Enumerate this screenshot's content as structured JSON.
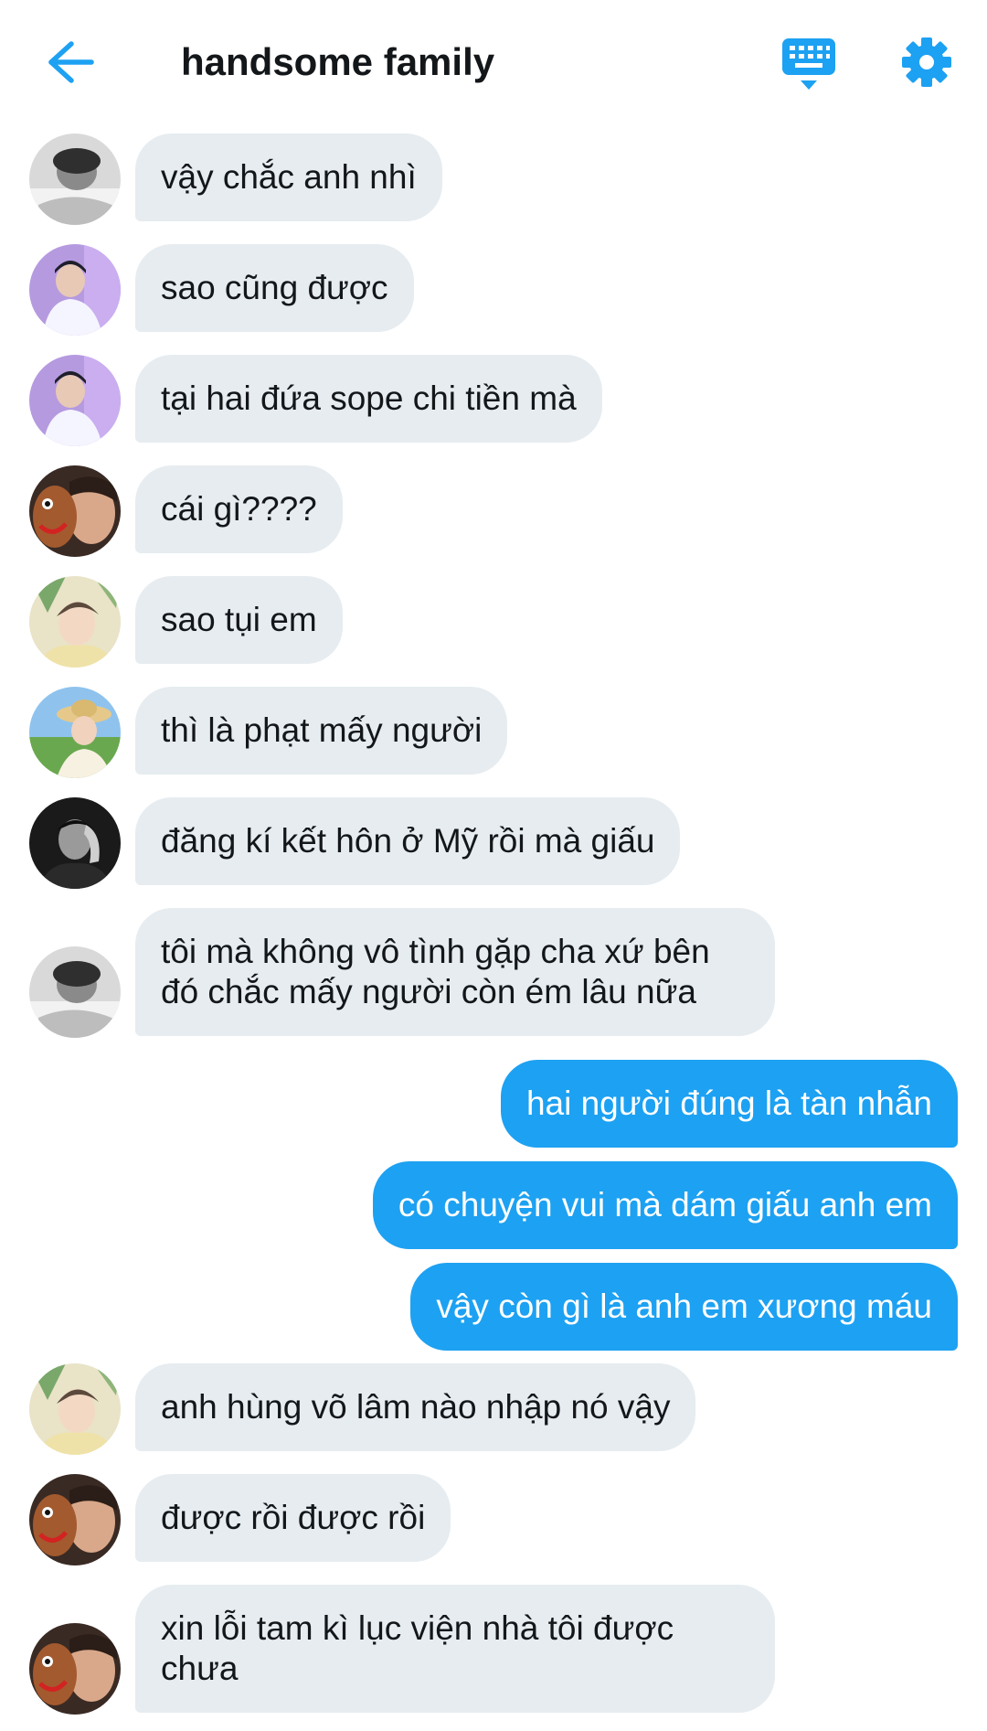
{
  "header": {
    "title": "handsome family",
    "back_icon": "arrow-left-icon",
    "keyboard_icon": "keyboard-icon",
    "settings_icon": "gear-icon",
    "accent_color": "#1da1f2"
  },
  "messages": [
    {
      "side": "in",
      "avatar": "avatar-1",
      "text": "vậy chắc anh nhì"
    },
    {
      "side": "in",
      "avatar": "avatar-2",
      "text": "sao cũng được"
    },
    {
      "side": "in",
      "avatar": "avatar-2",
      "text": "tại hai đứa sope chi tiền mà"
    },
    {
      "side": "in",
      "avatar": "avatar-3",
      "text": "cái gì????"
    },
    {
      "side": "in",
      "avatar": "avatar-4",
      "text": "sao tụi em"
    },
    {
      "side": "in",
      "avatar": "avatar-5",
      "text": "thì là phạt mấy người"
    },
    {
      "side": "in",
      "avatar": "avatar-6",
      "text": "đăng kí kết hôn ở Mỹ rồi mà giấu"
    },
    {
      "side": "in",
      "avatar": "avatar-1",
      "text": "tôi mà không vô tình gặp cha xứ bên đó chắc mấy người còn ém lâu nữa"
    },
    {
      "side": "out",
      "text": "hai người đúng là tàn nhẫn"
    },
    {
      "side": "out",
      "text": "có chuyện vui mà dám giấu anh em"
    },
    {
      "side": "out",
      "text": "vậy còn gì là anh em xương máu"
    },
    {
      "side": "in",
      "avatar": "avatar-4",
      "text": "anh hùng võ lâm nào nhập nó vậy"
    },
    {
      "side": "in",
      "avatar": "avatar-3",
      "text": "được rồi được rồi"
    },
    {
      "side": "in",
      "avatar": "avatar-3",
      "text": "xin lỗi tam kì lục viện nhà tôi được chưa"
    }
  ]
}
